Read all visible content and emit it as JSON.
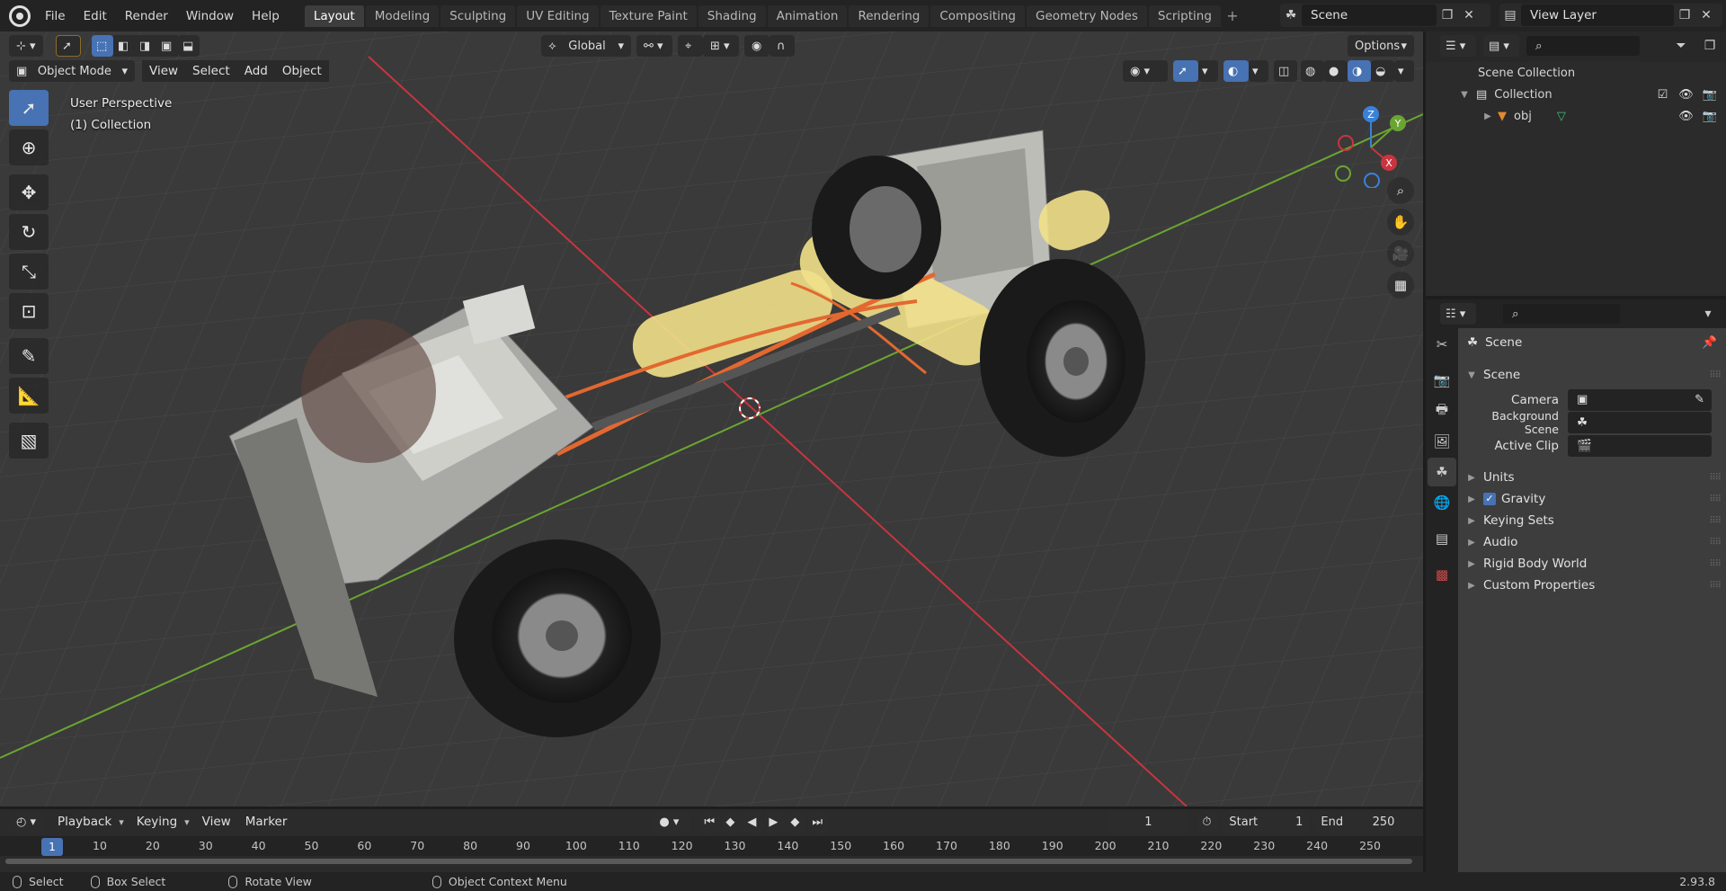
{
  "menu": [
    "File",
    "Edit",
    "Render",
    "Window",
    "Help"
  ],
  "workspaces": [
    {
      "label": "Layout",
      "active": true
    },
    {
      "label": "Modeling"
    },
    {
      "label": "Sculpting"
    },
    {
      "label": "UV Editing"
    },
    {
      "label": "Texture Paint"
    },
    {
      "label": "Shading"
    },
    {
      "label": "Animation"
    },
    {
      "label": "Rendering"
    },
    {
      "label": "Compositing"
    },
    {
      "label": "Geometry Nodes"
    },
    {
      "label": "Scripting"
    }
  ],
  "scene_selector": {
    "value": "Scene"
  },
  "view_layer_selector": {
    "value": "View Layer"
  },
  "viewport": {
    "transform_orientation": "Global",
    "options_label": "Options",
    "mode": "Object Mode",
    "menus": [
      "View",
      "Select",
      "Add",
      "Object"
    ],
    "overlay_line1": "User Perspective",
    "overlay_line2": "(1) Collection",
    "gizmo_axes": {
      "z": "Z",
      "y": "Y",
      "x": "X"
    }
  },
  "outliner": {
    "root": "Scene Collection",
    "collection": "Collection",
    "object": "obj"
  },
  "properties": {
    "header": "Scene",
    "panel_title": "Scene",
    "camera_label": "Camera",
    "background_scene_label": "Background Scene",
    "active_clip_label": "Active Clip",
    "sections": [
      "Units",
      "Gravity",
      "Keying Sets",
      "Audio",
      "Rigid Body World",
      "Custom Properties"
    ],
    "gravity_checked": true
  },
  "timeline": {
    "menus": [
      "Playback",
      "Keying",
      "View",
      "Marker"
    ],
    "current_frame": "1",
    "start_label": "Start",
    "start_value": "1",
    "end_label": "End",
    "end_value": "250",
    "ruler_marks": [
      "1",
      "10",
      "20",
      "30",
      "40",
      "50",
      "60",
      "70",
      "80",
      "90",
      "100",
      "110",
      "120",
      "130",
      "140",
      "150",
      "160",
      "170",
      "180",
      "190",
      "200",
      "210",
      "220",
      "230",
      "240",
      "250"
    ]
  },
  "statusbar": {
    "select": "Select",
    "box_select": "Box Select",
    "rotate_view": "Rotate View",
    "context_menu": "Object Context Menu",
    "version": "2.93.8"
  },
  "colors": {
    "accent": "#4772b3",
    "x_axis": "#c8353f",
    "y_axis": "#6aa532",
    "z_axis": "#3a82d8",
    "hose": "#e3682f",
    "tank": "#f2e08a"
  }
}
